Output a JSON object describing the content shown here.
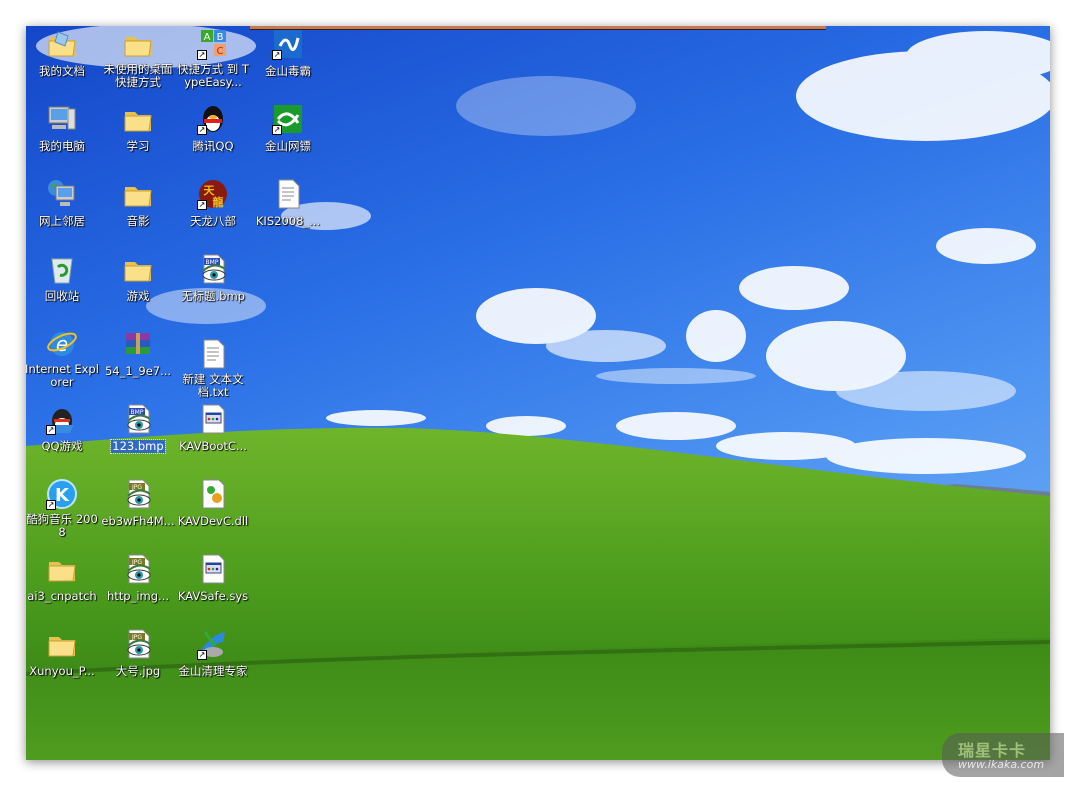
{
  "desktop": {
    "icons": [
      {
        "label": "我的文档",
        "icon": "my-documents",
        "shortcut": false
      },
      {
        "label": "我的电脑",
        "icon": "my-computer",
        "shortcut": false
      },
      {
        "label": "网上邻居",
        "icon": "network",
        "shortcut": false
      },
      {
        "label": "回收站",
        "icon": "recycle-bin",
        "shortcut": false
      },
      {
        "label": "Internet Explorer",
        "icon": "ie",
        "shortcut": false
      },
      {
        "label": "QQ游戏",
        "icon": "qq-game",
        "shortcut": true
      },
      {
        "label": "酷狗音乐 2008",
        "icon": "kugou",
        "shortcut": true
      },
      {
        "label": "ai3_cnpatch",
        "icon": "folder",
        "shortcut": false
      },
      {
        "label": "Xunyou_P...",
        "icon": "folder",
        "shortcut": false
      },
      {
        "label": "未使用的桌面快捷方式",
        "icon": "folder",
        "shortcut": false
      },
      {
        "label": "学习",
        "icon": "folder",
        "shortcut": false
      },
      {
        "label": "音影",
        "icon": "folder",
        "shortcut": false
      },
      {
        "label": "游戏",
        "icon": "folder",
        "shortcut": false
      },
      {
        "label": "54_1_9e7...",
        "icon": "rar",
        "shortcut": false
      },
      {
        "label": "123.bmp",
        "icon": "bmp",
        "shortcut": false,
        "selected": true
      },
      {
        "label": "eb3wFh4M...",
        "icon": "jpg",
        "shortcut": false
      },
      {
        "label": "http_img...",
        "icon": "jpg",
        "shortcut": false
      },
      {
        "label": "大号.jpg",
        "icon": "jpg",
        "shortcut": false
      },
      {
        "label": "快捷方式 到 TypeEasy...",
        "icon": "abc",
        "shortcut": true
      },
      {
        "label": "腾讯QQ",
        "icon": "qq",
        "shortcut": true
      },
      {
        "label": "天龙八部",
        "icon": "tlbb",
        "shortcut": true
      },
      {
        "label": "无标题.bmp",
        "icon": "bmp",
        "shortcut": false
      },
      {
        "label": "新建 文本文档.txt",
        "icon": "txt",
        "shortcut": false
      },
      {
        "label": "KAVBootC...",
        "icon": "sys",
        "shortcut": false
      },
      {
        "label": "KAVDevC.dll",
        "icon": "dll",
        "shortcut": false
      },
      {
        "label": "KAVSafe.sys",
        "icon": "sys",
        "shortcut": false
      },
      {
        "label": "金山清理专家",
        "icon": "cleaner",
        "shortcut": true
      },
      {
        "label": "金山毒霸",
        "icon": "duba",
        "shortcut": true
      },
      {
        "label": "金山网镖",
        "icon": "wangbiao",
        "shortcut": true
      },
      {
        "label": "KIS2008_...",
        "icon": "txt",
        "shortcut": false
      }
    ]
  },
  "watermark": {
    "title": "瑞星卡卡",
    "url": "www.ikaka.com"
  },
  "colors": {
    "selection": "#316ac5",
    "grass": "#3f8f1a",
    "sky": "#2a6fe6"
  }
}
